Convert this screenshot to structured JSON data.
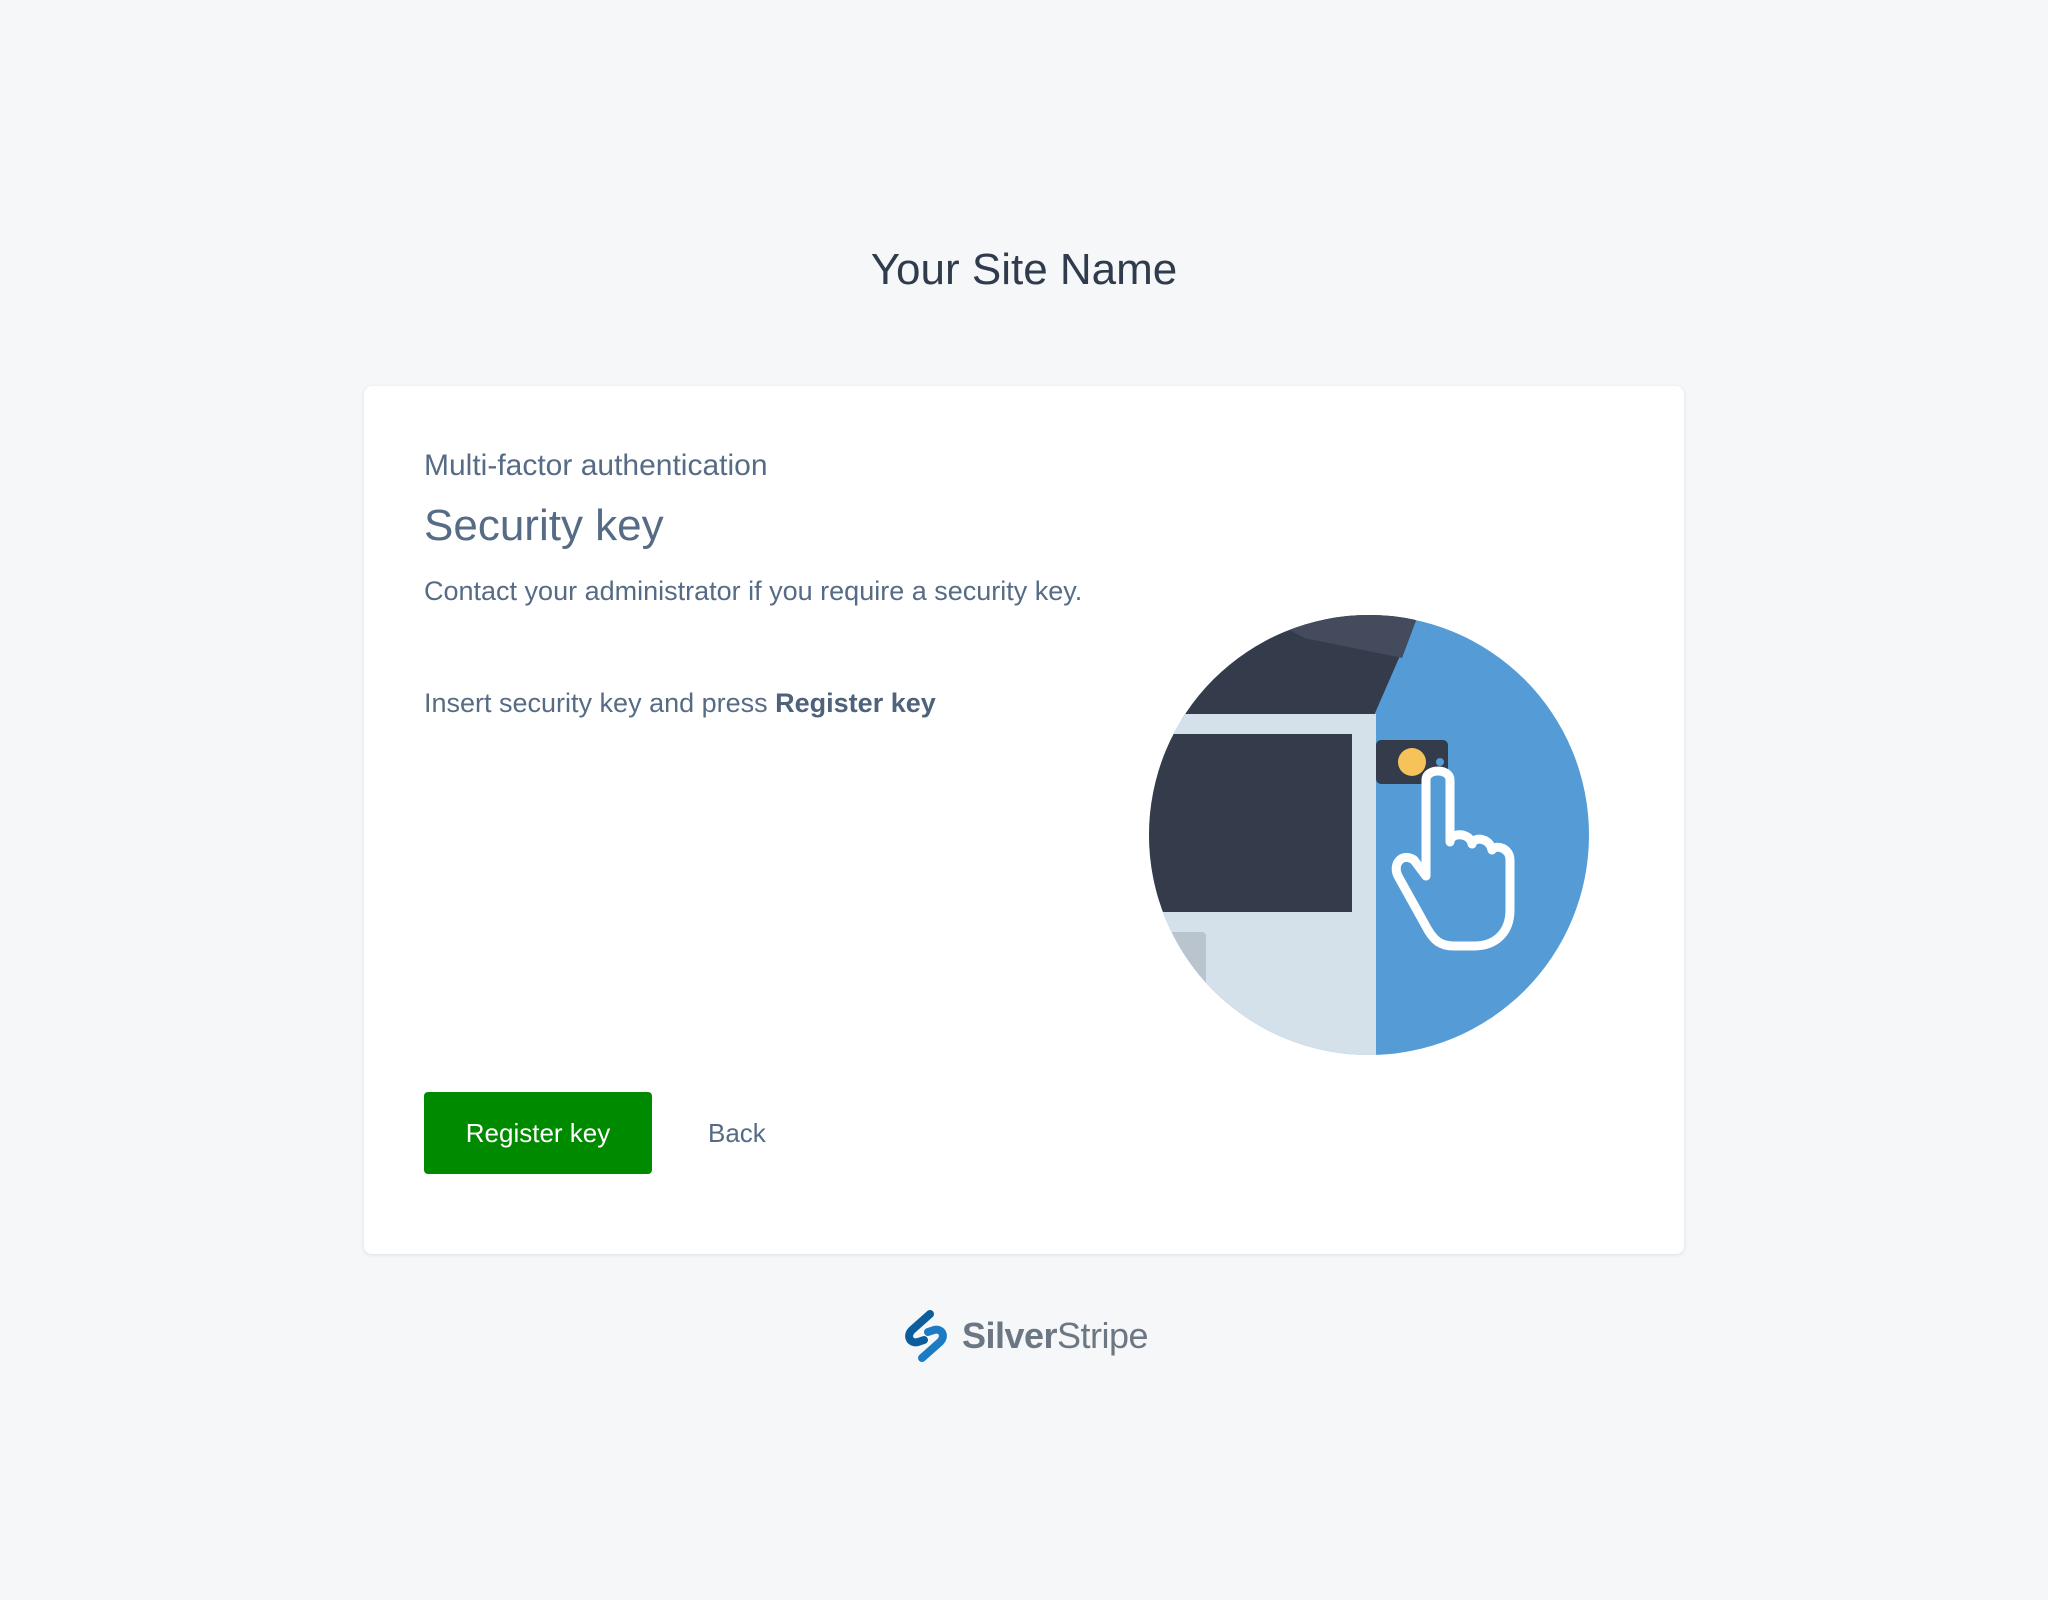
{
  "site": {
    "name": "Your Site Name"
  },
  "card": {
    "subtitle": "Multi-factor authentication",
    "title": "Security key",
    "description": "Contact your administrator if you require a security key.",
    "instruction_prefix": "Insert security key and press ",
    "instruction_bold": "Register key"
  },
  "actions": {
    "register_label": "Register key",
    "back_label": "Back"
  },
  "footer": {
    "logo_bold": "Silver",
    "logo_light": "Stripe"
  },
  "colors": {
    "background": "#f6f7f9",
    "primary_button": "#008a00",
    "text": "#566b85",
    "illustration_blue": "#559cd6",
    "illustration_dark": "#343b4a",
    "logo_blue": "#0b5d9c"
  },
  "icons": {
    "illustration": "security-key-illustration",
    "logo": "silverstripe-logo-icon"
  }
}
